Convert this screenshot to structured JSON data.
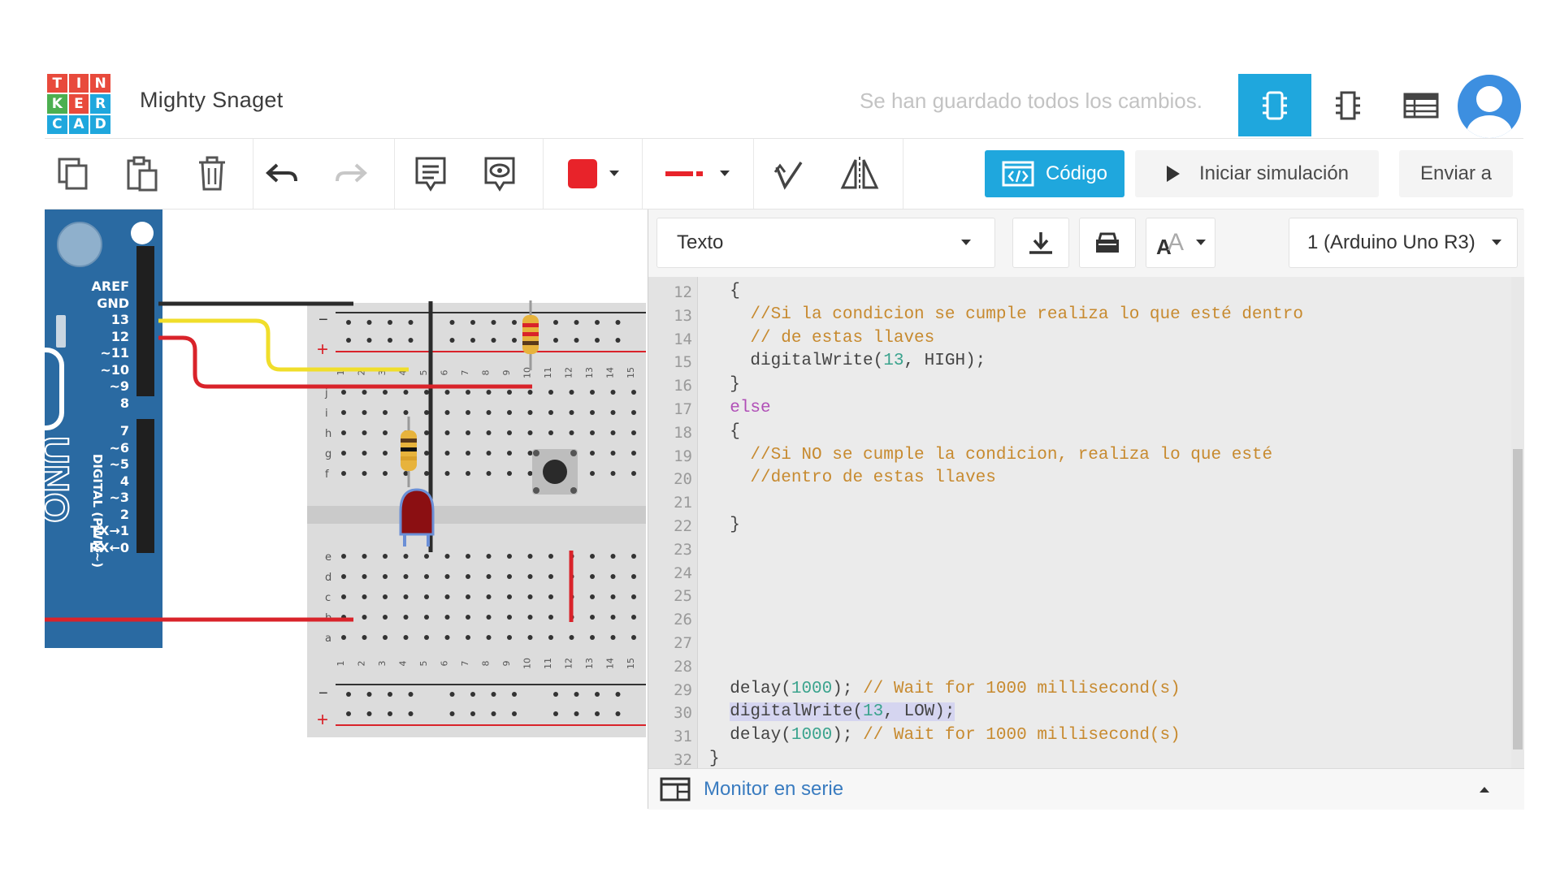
{
  "brand": {
    "logo_letters": [
      "T",
      "I",
      "N",
      "K",
      "E",
      "R",
      "C",
      "A",
      "D"
    ],
    "logo_colors": [
      "#e84a3c",
      "#e84a3c",
      "#e84a3c",
      "#4caf50",
      "#e84a3c",
      "#1fa7dd",
      "#1fa7dd",
      "#1fa7dd",
      "#1fa7dd"
    ]
  },
  "header": {
    "title": "Mighty Snaget",
    "save_status": "Se han guardado todos los cambios.",
    "view_buttons": [
      "circuit-view-icon",
      "schematic-view-icon",
      "component-list-icon"
    ],
    "accent": "#1fa7dd"
  },
  "toolbar": {
    "buttons": [
      "copy-icon",
      "paste-icon",
      "delete-icon",
      "undo-icon",
      "redo-icon",
      "note-icon",
      "visibility-icon",
      "color-swatch",
      "line-style",
      "rotate-icon",
      "mirror-icon"
    ],
    "color_value": "#e8232a",
    "codigo_label": "Código",
    "simulate_label": "Iniciar simulación",
    "send_label": "Enviar a"
  },
  "board": {
    "pins_top": [
      "AREF",
      "GND",
      "13",
      "12",
      "~11",
      "~10",
      "~9",
      "8"
    ],
    "pins_bottom": [
      "7",
      "~6",
      "~5",
      "4",
      "~3",
      "2",
      "TX→1",
      "RX←0"
    ],
    "digital_label": "DIGITAL (PWM~)",
    "brand_text": "UNO",
    "breadboard_rows_top": [
      "j",
      "i",
      "h",
      "g",
      "f"
    ],
    "breadboard_rows_bottom": [
      "e",
      "d",
      "c",
      "b",
      "a"
    ],
    "breadboard_columns": [
      "1",
      "2",
      "3",
      "4",
      "5",
      "6",
      "7",
      "8",
      "9",
      "10",
      "11",
      "12",
      "13",
      "14",
      "15"
    ],
    "rail_minus": "−",
    "rail_plus": "+"
  },
  "code_panel": {
    "mode_select": "Texto",
    "device_select": "1 (Arduino Uno R3)",
    "serial_monitor": "Monitor en serie",
    "line_numbers": [
      "12",
      "13",
      "14",
      "15",
      "16",
      "17",
      "18",
      "19",
      "20",
      "21",
      "22",
      "23",
      "24",
      "25",
      "26",
      "27",
      "28",
      "29",
      "30",
      "31",
      "32"
    ],
    "lines": [
      {
        "indent": "  ",
        "parts": [
          {
            "t": "{",
            "c": "fn"
          }
        ]
      },
      {
        "indent": "    ",
        "parts": [
          {
            "t": "//Si la condicion se cumple realiza lo que esté dentro",
            "c": "cm"
          }
        ]
      },
      {
        "indent": "    ",
        "parts": [
          {
            "t": "// de estas llaves",
            "c": "cm"
          }
        ]
      },
      {
        "indent": "    ",
        "parts": [
          {
            "t": "digitalWrite(",
            "c": "fn"
          },
          {
            "t": "13",
            "c": "num"
          },
          {
            "t": ", HIGH);",
            "c": "fn"
          }
        ]
      },
      {
        "indent": "  ",
        "parts": [
          {
            "t": "}",
            "c": "fn"
          }
        ]
      },
      {
        "indent": "  ",
        "parts": [
          {
            "t": "else",
            "c": "kw"
          }
        ]
      },
      {
        "indent": "  ",
        "parts": [
          {
            "t": "{",
            "c": "fn"
          }
        ]
      },
      {
        "indent": "    ",
        "parts": [
          {
            "t": "//Si NO se cumple la condicion, realiza lo que esté",
            "c": "cm"
          }
        ]
      },
      {
        "indent": "    ",
        "parts": [
          {
            "t": "//dentro de estas llaves",
            "c": "cm"
          }
        ]
      },
      {
        "indent": "",
        "parts": []
      },
      {
        "indent": "  ",
        "parts": [
          {
            "t": "}",
            "c": "fn"
          }
        ]
      },
      {
        "indent": "",
        "parts": []
      },
      {
        "indent": "",
        "parts": []
      },
      {
        "indent": "",
        "parts": []
      },
      {
        "indent": "",
        "parts": []
      },
      {
        "indent": "",
        "parts": []
      },
      {
        "indent": "",
        "parts": []
      },
      {
        "indent": "  ",
        "parts": [
          {
            "t": "delay(",
            "c": "fn"
          },
          {
            "t": "1000",
            "c": "num"
          },
          {
            "t": "); ",
            "c": "fn"
          },
          {
            "t": "// Wait for 1000 millisecond(s)",
            "c": "cm"
          }
        ]
      },
      {
        "indent": "  ",
        "highlight": true,
        "parts": [
          {
            "t": "digitalWrite(",
            "c": "fn"
          },
          {
            "t": "13",
            "c": "num"
          },
          {
            "t": ", LOW);",
            "c": "fn"
          }
        ]
      },
      {
        "indent": "  ",
        "parts": [
          {
            "t": "delay(",
            "c": "fn"
          },
          {
            "t": "1000",
            "c": "num"
          },
          {
            "t": "); ",
            "c": "fn"
          },
          {
            "t": "// Wait for 1000 millisecond(s)",
            "c": "cm"
          }
        ]
      },
      {
        "indent": "",
        "parts": [
          {
            "t": "}",
            "c": "fn"
          }
        ]
      }
    ]
  }
}
